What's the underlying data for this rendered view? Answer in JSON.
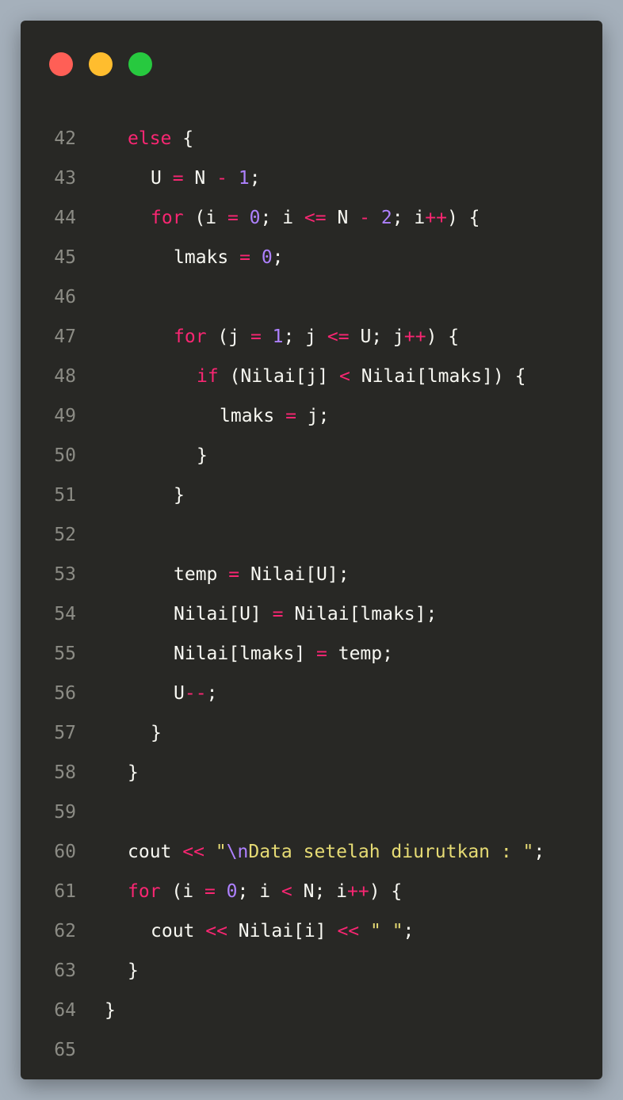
{
  "window": {
    "traffic_lights": [
      {
        "name": "close",
        "color": "#ff5f56"
      },
      {
        "name": "minimize",
        "color": "#ffbd2e"
      },
      {
        "name": "maximize",
        "color": "#27c93f"
      }
    ]
  },
  "colors": {
    "background": "#a5b0bb",
    "editor": "#282825",
    "keyword": "#f92672",
    "number": "#ae81ff",
    "string": "#e6db74",
    "text": "#f8f8f2",
    "line_number": "#8c8c85"
  },
  "code": {
    "lines": [
      {
        "num": "42",
        "indent": 1,
        "tokens": [
          [
            "kw",
            "else"
          ],
          [
            "pn",
            " {"
          ]
        ]
      },
      {
        "num": "43",
        "indent": 2,
        "tokens": [
          [
            "id",
            "U "
          ],
          [
            "op",
            "="
          ],
          [
            "id",
            " N "
          ],
          [
            "op",
            "-"
          ],
          [
            "pn",
            " "
          ],
          [
            "num",
            "1"
          ],
          [
            "pn",
            ";"
          ]
        ]
      },
      {
        "num": "44",
        "indent": 2,
        "tokens": [
          [
            "kw",
            "for"
          ],
          [
            "pn",
            " (i "
          ],
          [
            "op",
            "="
          ],
          [
            "pn",
            " "
          ],
          [
            "num",
            "0"
          ],
          [
            "pn",
            "; i "
          ],
          [
            "op",
            "<="
          ],
          [
            "pn",
            " N "
          ],
          [
            "op",
            "-"
          ],
          [
            "pn",
            " "
          ],
          [
            "num",
            "2"
          ],
          [
            "pn",
            "; i"
          ],
          [
            "op",
            "++"
          ],
          [
            "pn",
            ") {"
          ]
        ]
      },
      {
        "num": "45",
        "indent": 3,
        "tokens": [
          [
            "id",
            "lmaks "
          ],
          [
            "op",
            "="
          ],
          [
            "pn",
            " "
          ],
          [
            "num",
            "0"
          ],
          [
            "pn",
            ";"
          ]
        ]
      },
      {
        "num": "46",
        "indent": 0,
        "tokens": []
      },
      {
        "num": "47",
        "indent": 3,
        "tokens": [
          [
            "kw",
            "for"
          ],
          [
            "pn",
            " (j "
          ],
          [
            "op",
            "="
          ],
          [
            "pn",
            " "
          ],
          [
            "num",
            "1"
          ],
          [
            "pn",
            "; j "
          ],
          [
            "op",
            "<="
          ],
          [
            "pn",
            " U; j"
          ],
          [
            "op",
            "++"
          ],
          [
            "pn",
            ") {"
          ]
        ]
      },
      {
        "num": "48",
        "indent": 4,
        "tokens": [
          [
            "kw",
            "if"
          ],
          [
            "pn",
            " (Nilai[j] "
          ],
          [
            "op",
            "<"
          ],
          [
            "pn",
            " Nilai[lmaks]) {"
          ]
        ]
      },
      {
        "num": "49",
        "indent": 5,
        "tokens": [
          [
            "id",
            "lmaks "
          ],
          [
            "op",
            "="
          ],
          [
            "pn",
            " j;"
          ]
        ]
      },
      {
        "num": "50",
        "indent": 4,
        "tokens": [
          [
            "pn",
            "}"
          ]
        ]
      },
      {
        "num": "51",
        "indent": 3,
        "tokens": [
          [
            "pn",
            "}"
          ]
        ]
      },
      {
        "num": "52",
        "indent": 0,
        "tokens": []
      },
      {
        "num": "53",
        "indent": 3,
        "tokens": [
          [
            "id",
            "temp "
          ],
          [
            "op",
            "="
          ],
          [
            "pn",
            " Nilai[U];"
          ]
        ]
      },
      {
        "num": "54",
        "indent": 3,
        "tokens": [
          [
            "id",
            "Nilai[U] "
          ],
          [
            "op",
            "="
          ],
          [
            "pn",
            " Nilai[lmaks];"
          ]
        ]
      },
      {
        "num": "55",
        "indent": 3,
        "tokens": [
          [
            "id",
            "Nilai[lmaks] "
          ],
          [
            "op",
            "="
          ],
          [
            "pn",
            " temp;"
          ]
        ]
      },
      {
        "num": "56",
        "indent": 3,
        "tokens": [
          [
            "id",
            "U"
          ],
          [
            "op",
            "--"
          ],
          [
            "pn",
            ";"
          ]
        ]
      },
      {
        "num": "57",
        "indent": 2,
        "tokens": [
          [
            "pn",
            "}"
          ]
        ]
      },
      {
        "num": "58",
        "indent": 1,
        "tokens": [
          [
            "pn",
            "}"
          ]
        ]
      },
      {
        "num": "59",
        "indent": 0,
        "tokens": []
      },
      {
        "num": "60",
        "indent": 1,
        "tokens": [
          [
            "id",
            "cout "
          ],
          [
            "op",
            "<<"
          ],
          [
            "pn",
            " "
          ],
          [
            "str",
            "\""
          ],
          [
            "esc",
            "\\n"
          ],
          [
            "str",
            "Data setelah diurutkan : \""
          ],
          [
            "pn",
            ";"
          ]
        ]
      },
      {
        "num": "61",
        "indent": 1,
        "tokens": [
          [
            "kw",
            "for"
          ],
          [
            "pn",
            " (i "
          ],
          [
            "op",
            "="
          ],
          [
            "pn",
            " "
          ],
          [
            "num",
            "0"
          ],
          [
            "pn",
            "; i "
          ],
          [
            "op",
            "<"
          ],
          [
            "pn",
            " N; i"
          ],
          [
            "op",
            "++"
          ],
          [
            "pn",
            ") {"
          ]
        ]
      },
      {
        "num": "62",
        "indent": 2,
        "tokens": [
          [
            "id",
            "cout "
          ],
          [
            "op",
            "<<"
          ],
          [
            "pn",
            " Nilai[i] "
          ],
          [
            "op",
            "<<"
          ],
          [
            "pn",
            " "
          ],
          [
            "str",
            "\" \""
          ],
          [
            "pn",
            ";"
          ]
        ]
      },
      {
        "num": "63",
        "indent": 1,
        "tokens": [
          [
            "pn",
            "}"
          ]
        ]
      },
      {
        "num": "64",
        "indent": 0,
        "tokens": [
          [
            "pn",
            "}"
          ]
        ]
      },
      {
        "num": "65",
        "indent": 0,
        "tokens": []
      }
    ]
  }
}
